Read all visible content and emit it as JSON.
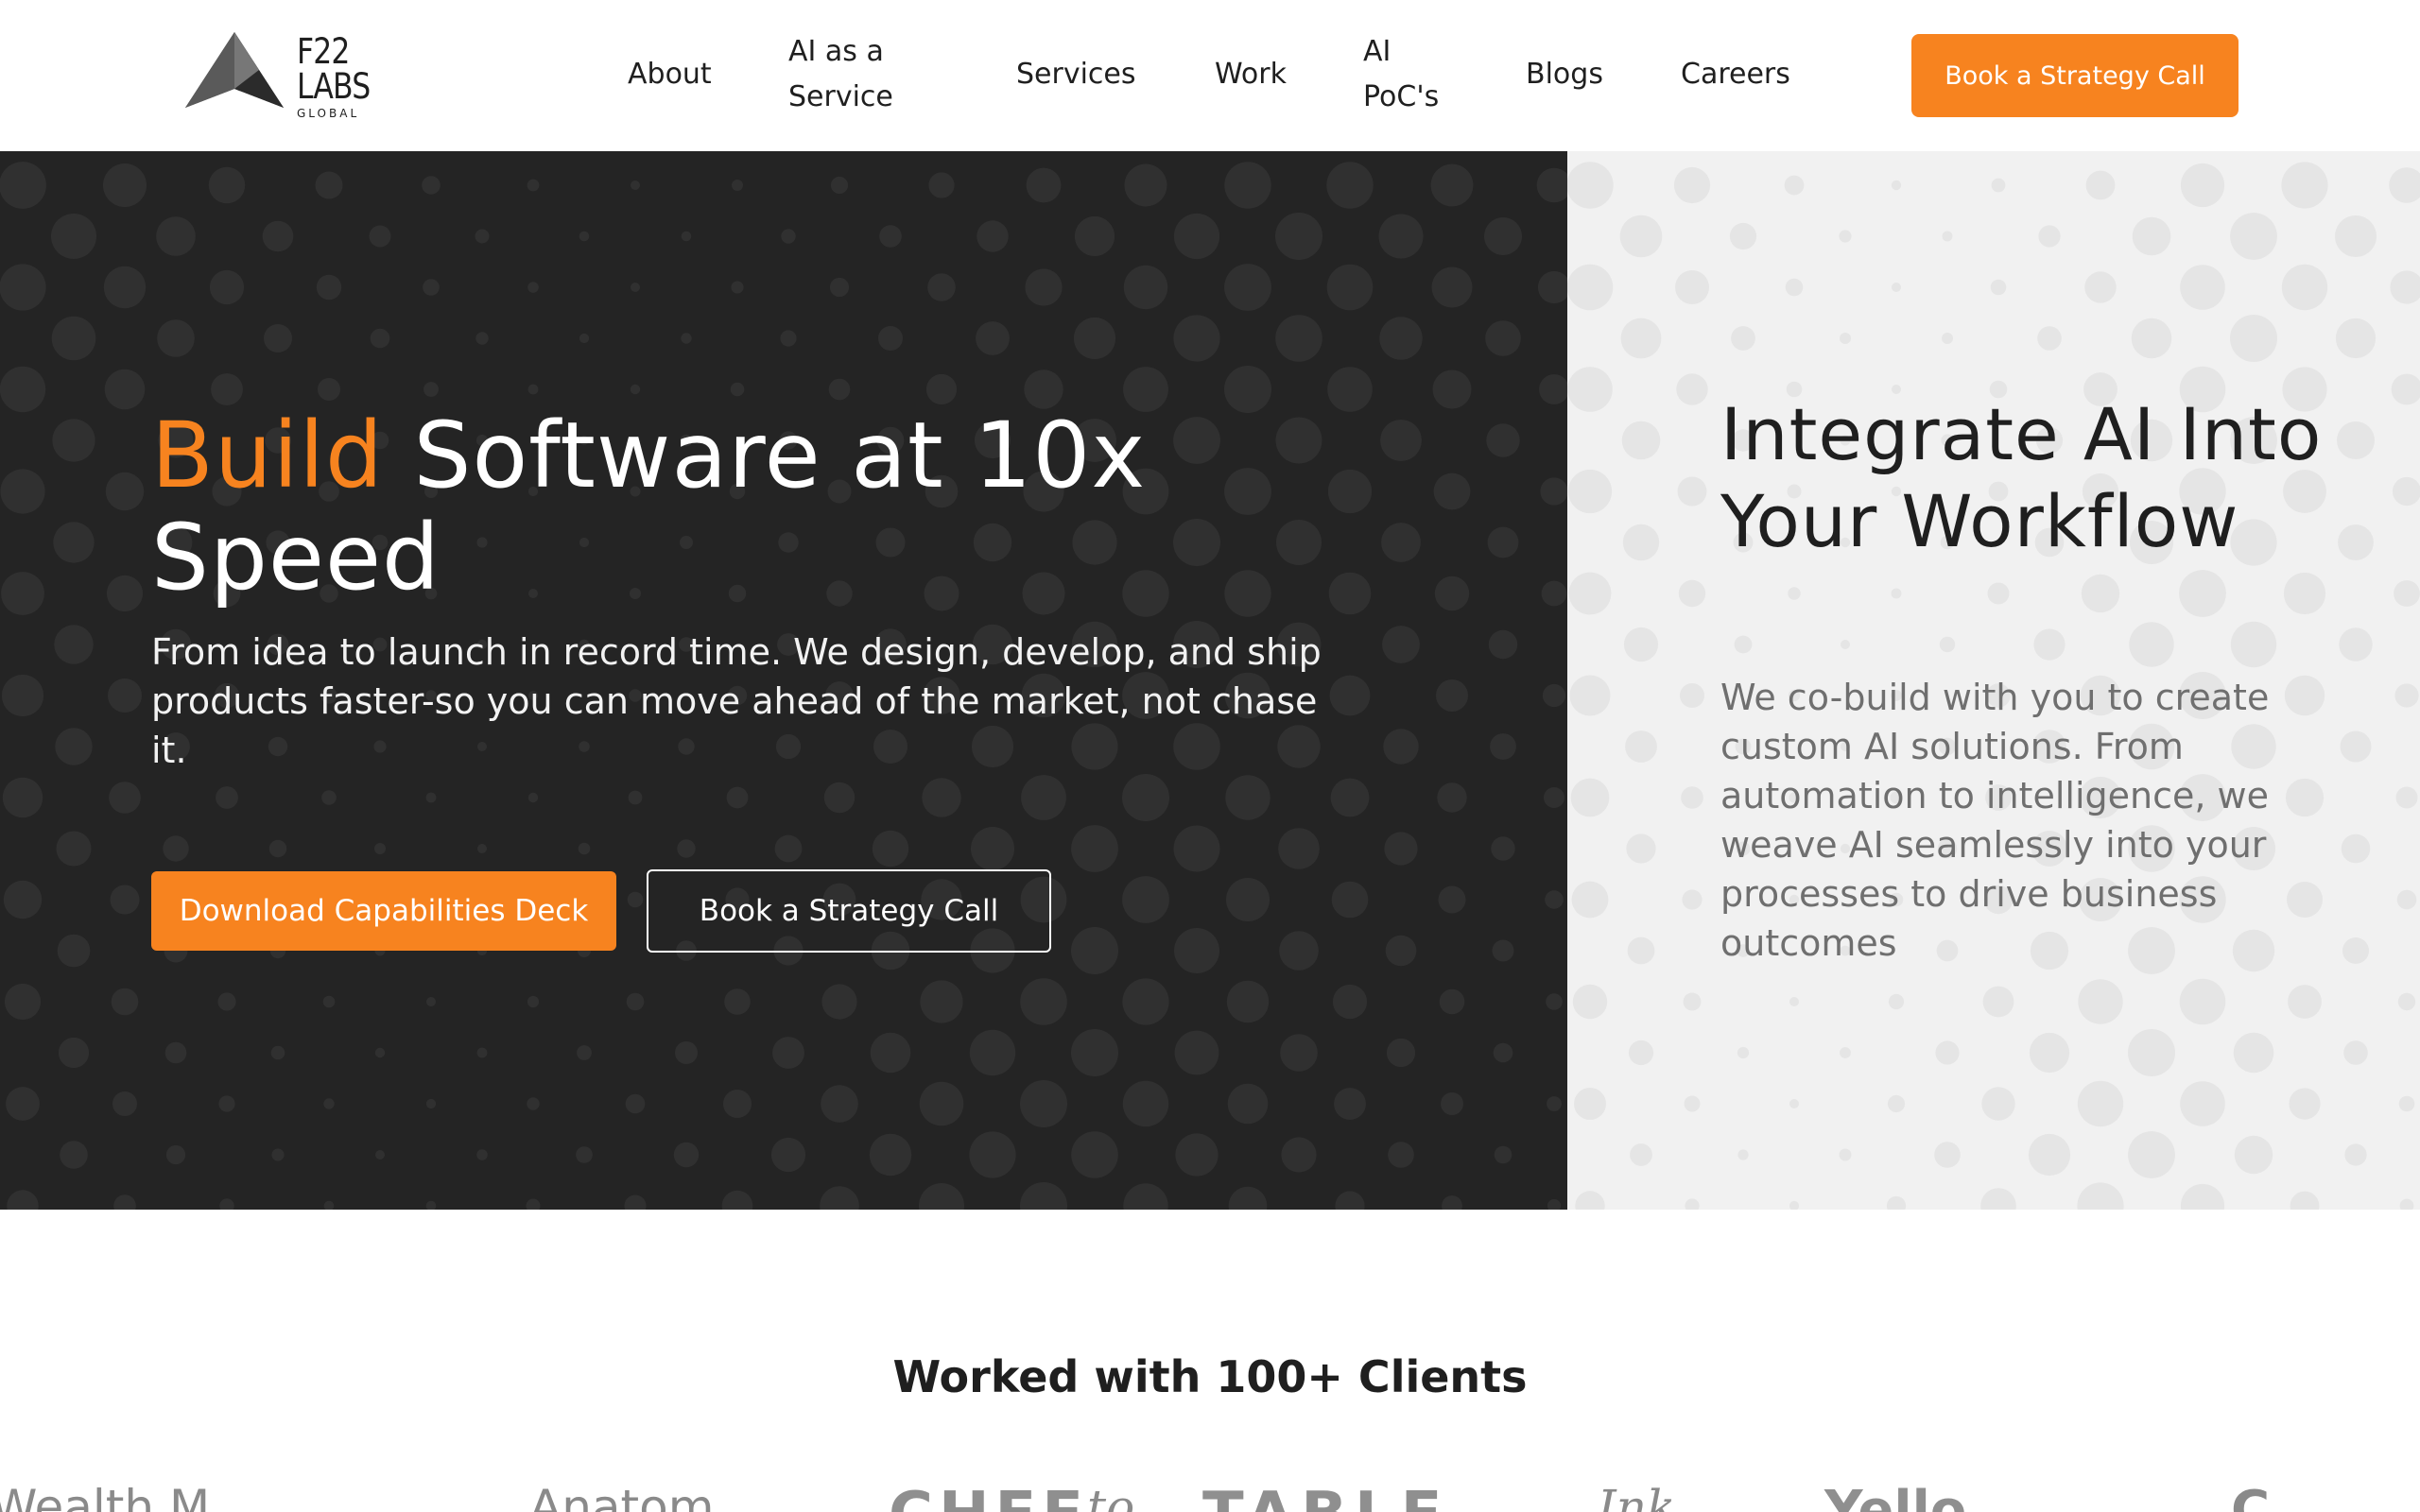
{
  "brand": {
    "line1": "F22",
    "line2": "LABS",
    "line3": "GLOBAL",
    "accent_color": "#f7831f",
    "dark_bg": "#242424",
    "light_bg": "#f1f1f1"
  },
  "nav": {
    "about": "About",
    "ai_service_l1": "AI as a",
    "ai_service_l2": "Service",
    "services": "Services",
    "work": "Work",
    "ai_poc_l1": "AI",
    "ai_poc_l2": "PoC's",
    "blogs": "Blogs",
    "careers": "Careers",
    "cta": "Book a Strategy Call"
  },
  "hero": {
    "title_accent": "Build",
    "title_rest": " Software at 10x Speed",
    "subtitle": "From idea to launch in record time. We design, develop, and ship products faster-so you can move ahead of the market, not chase it.",
    "primary_button": "Download Capabilities Deck",
    "secondary_button": "Book a Strategy Call"
  },
  "side_panel": {
    "title": "Integrate AI Into Your Workflow",
    "text": "We co-build with you to create custom AI solutions. From automation to intelligence, we weave AI seamlessly into your processes to drive business outcomes"
  },
  "clients": {
    "title": "Worked with 100+ Clients",
    "logos": [
      {
        "name": "wealth-logo",
        "text": "Wealth M"
      },
      {
        "name": "person-logo",
        "text": "Anatom"
      },
      {
        "name": "chef-logo",
        "text": "CHEF"
      },
      {
        "name": "chef-script-logo",
        "text": "to"
      },
      {
        "name": "table-logo",
        "text": "TABLE"
      },
      {
        "name": "script-logo",
        "text": "Ink"
      },
      {
        "name": "yello-logo",
        "text": "Yello"
      },
      {
        "name": "circle-logo",
        "text": "C"
      }
    ]
  }
}
